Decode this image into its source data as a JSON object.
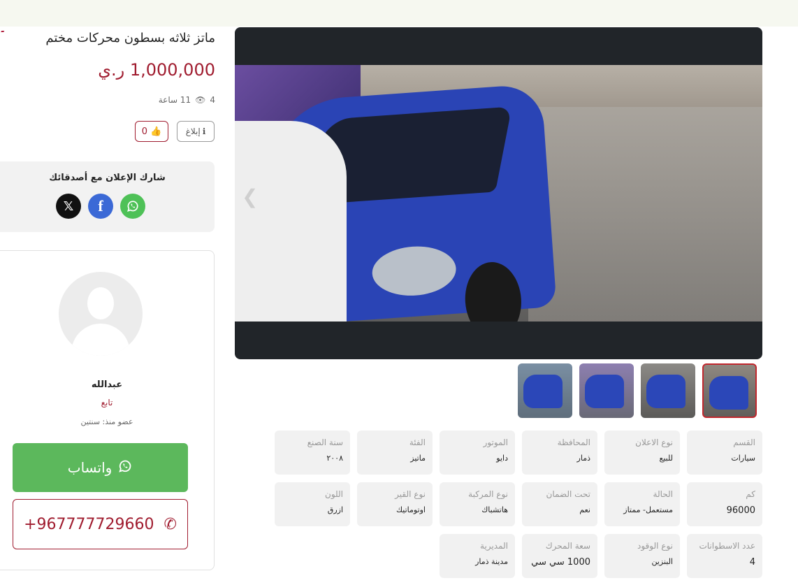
{
  "listing": {
    "title": "ماتز ثلاثه بسطون محركات مختم",
    "price": "1,000,000 ر.ي",
    "views": "4",
    "time_ago": "11 ساعة",
    "likes": "0",
    "report_label": "إبلاغ"
  },
  "share": {
    "title": "شارك الإعلان مع أصدقائك",
    "icons": [
      "x-icon",
      "facebook-icon",
      "whatsapp-icon"
    ]
  },
  "seller": {
    "name": "عبدالله",
    "follow_label": "تابع",
    "member_since": "عضو منذ: سنتين",
    "whatsapp_label": "واتساب",
    "phone": "+967777729660"
  },
  "gallery": {
    "thumbnail_count": 4,
    "active_thumbnail": 4
  },
  "specs": [
    {
      "label": "القسم",
      "value": "سيارات"
    },
    {
      "label": "نوع الاعلان",
      "value": "للبيع"
    },
    {
      "label": "المحافظة",
      "value": "ذمار"
    },
    {
      "label": "الموتور",
      "value": "دايو"
    },
    {
      "label": "الفئة",
      "value": "ماتيز"
    },
    {
      "label": "سنة الصنع",
      "value": "٢٠٠٨"
    },
    {
      "label": "كم",
      "value": "96000"
    },
    {
      "label": "الحالة",
      "value": "مستعمل- ممتاز"
    },
    {
      "label": "تحت الضمان",
      "value": "نعم"
    },
    {
      "label": "نوع المركبة",
      "value": "هاتشباك"
    },
    {
      "label": "نوع القير",
      "value": "اوتوماتيك"
    },
    {
      "label": "اللون",
      "value": "ازرق"
    },
    {
      "label": "عدد الاسطوانات",
      "value": "4"
    },
    {
      "label": "نوع الوقود",
      "value": "البنزين"
    },
    {
      "label": "سعة المحرك",
      "value": "1000 سي سي"
    },
    {
      "label": "المديرية",
      "value": "مدينة ذمار"
    }
  ],
  "colors": {
    "accent": "#a01c2f",
    "whatsapp": "#5cb85c",
    "topbar": "#f6f8f0"
  }
}
